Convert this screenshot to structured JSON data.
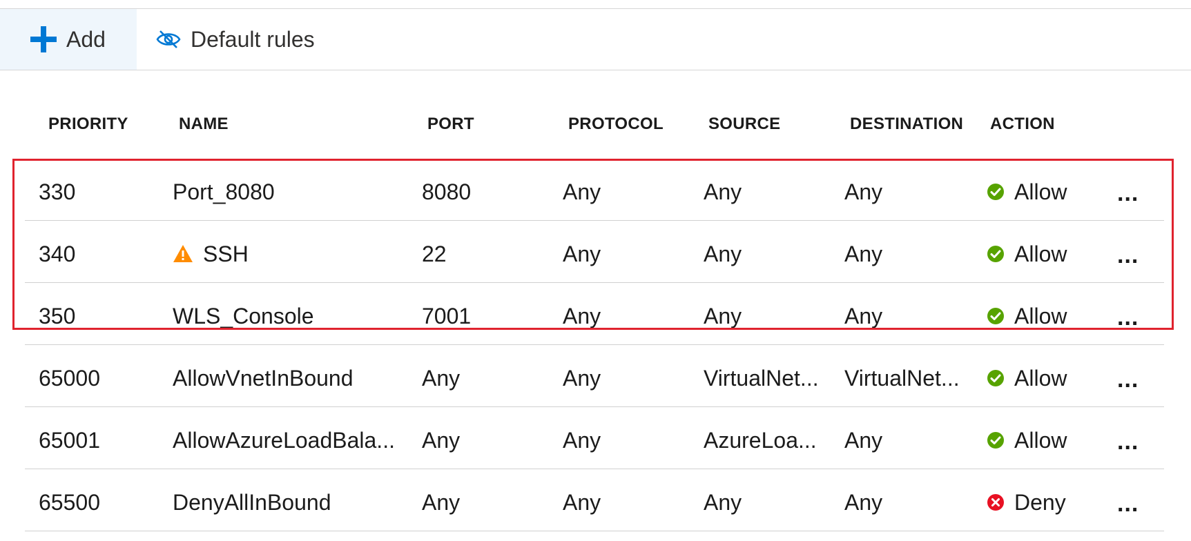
{
  "toolbar": {
    "add_label": "Add",
    "default_rules_label": "Default rules"
  },
  "columns": {
    "priority": "PRIORITY",
    "name": "NAME",
    "port": "PORT",
    "protocol": "PROTOCOL",
    "source": "SOURCE",
    "destination": "DESTINATION",
    "action": "ACTION"
  },
  "rows": [
    {
      "priority": "330",
      "name": "Port_8080",
      "warning": false,
      "port": "8080",
      "protocol": "Any",
      "source": "Any",
      "destination": "Any",
      "action": "Allow",
      "status": "allow",
      "more": "..."
    },
    {
      "priority": "340",
      "name": "SSH",
      "warning": true,
      "port": "22",
      "protocol": "Any",
      "source": "Any",
      "destination": "Any",
      "action": "Allow",
      "status": "allow",
      "more": "..."
    },
    {
      "priority": "350",
      "name": "WLS_Console",
      "warning": false,
      "port": "7001",
      "protocol": "Any",
      "source": "Any",
      "destination": "Any",
      "action": "Allow",
      "status": "allow",
      "more": "..."
    },
    {
      "priority": "65000",
      "name": "AllowVnetInBound",
      "warning": false,
      "port": "Any",
      "protocol": "Any",
      "source": "VirtualNet...",
      "destination": "VirtualNet...",
      "action": "Allow",
      "status": "allow",
      "more": "..."
    },
    {
      "priority": "65001",
      "name": "AllowAzureLoadBala...",
      "warning": false,
      "port": "Any",
      "protocol": "Any",
      "source": "AzureLoa...",
      "destination": "Any",
      "action": "Allow",
      "status": "allow",
      "more": "..."
    },
    {
      "priority": "65500",
      "name": "DenyAllInBound",
      "warning": false,
      "port": "Any",
      "protocol": "Any",
      "source": "Any",
      "destination": "Any",
      "action": "Deny",
      "status": "deny",
      "more": "..."
    }
  ],
  "icons": {
    "add": "plus-icon",
    "default_rules": "eye-hidden-icon",
    "warning": "warning-triangle-icon",
    "allow": "check-circle-icon",
    "deny": "error-circle-icon"
  },
  "colors": {
    "accent": "#0078d4",
    "allow": "#57a300",
    "deny": "#e81123",
    "warning": "#ff8c00",
    "highlight": "#e0232e"
  }
}
